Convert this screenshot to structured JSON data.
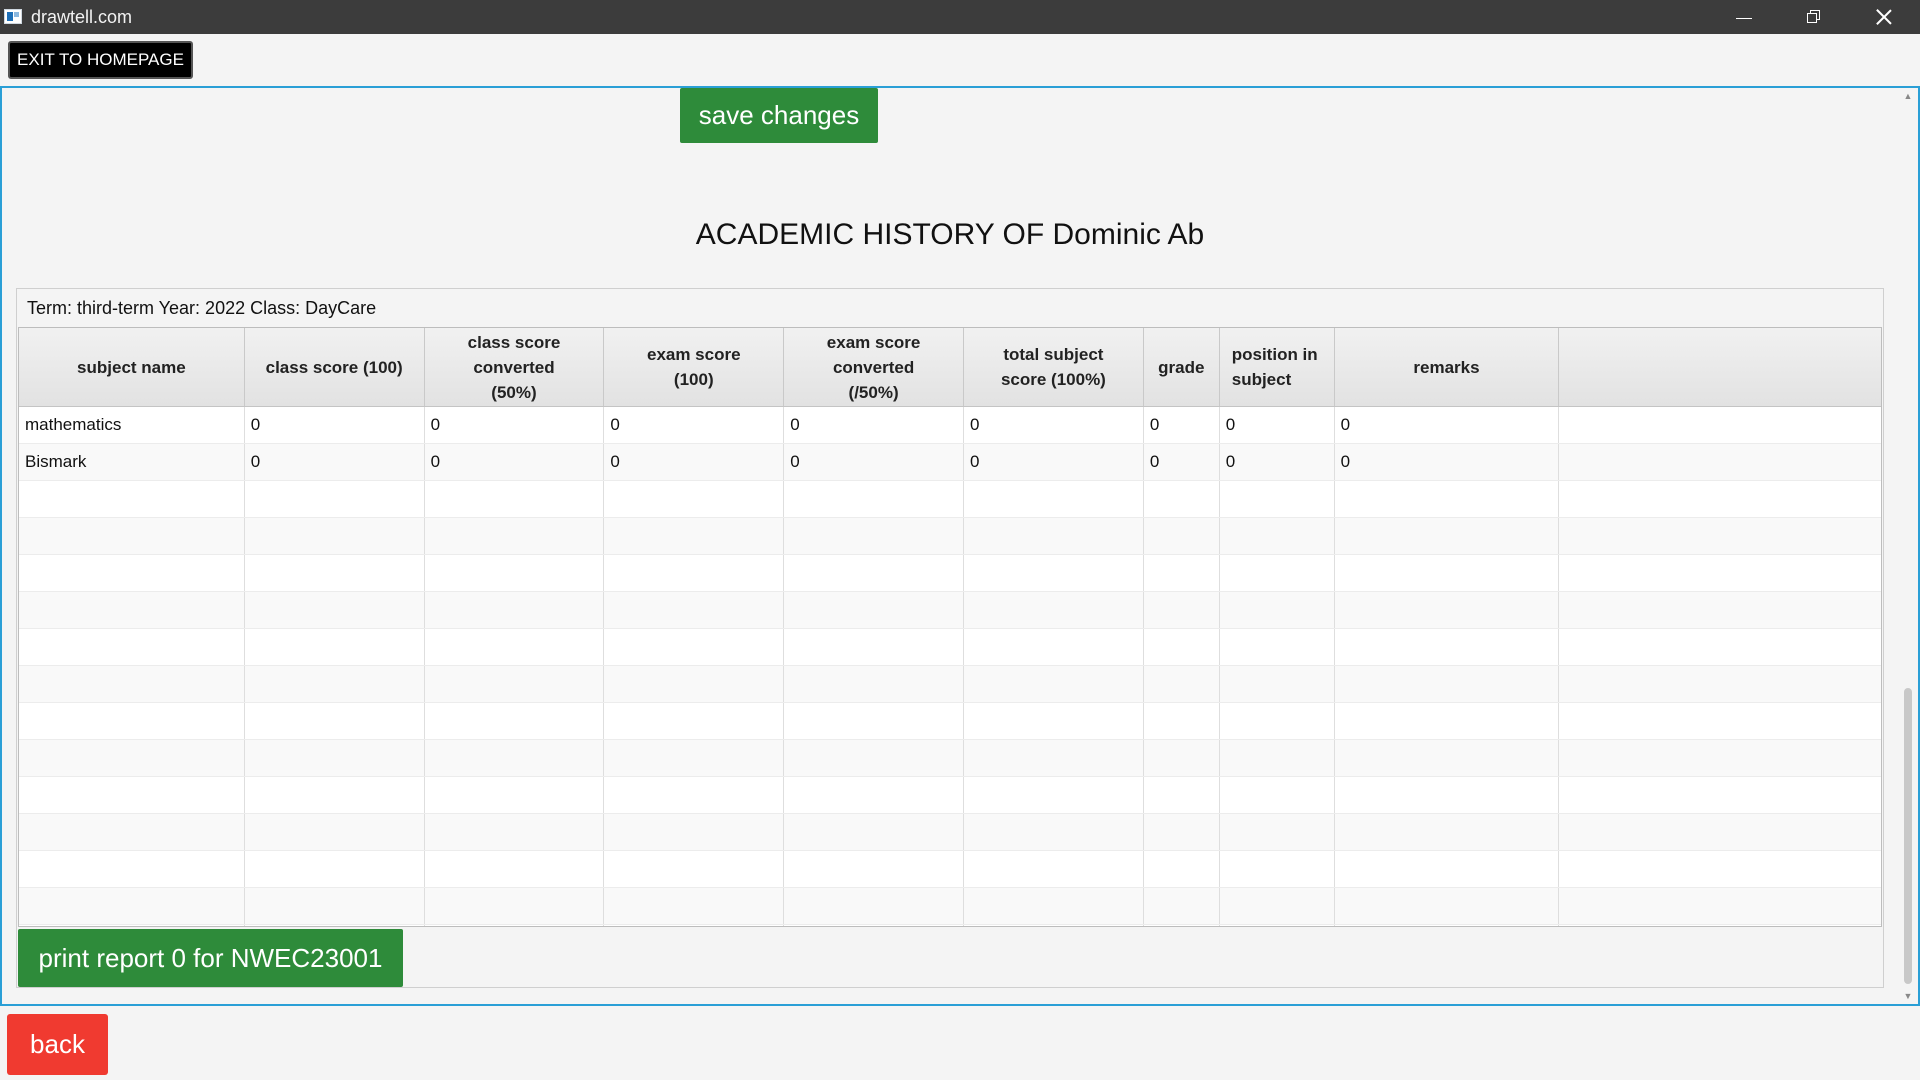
{
  "window": {
    "title": "drawtell.com",
    "icon": "app-window-icon",
    "controls": [
      "minimize-icon",
      "maximize-icon",
      "close-icon"
    ]
  },
  "toolbar": {
    "exit_label": "EXIT TO HOMEPAGE"
  },
  "main": {
    "save_label": "save changes",
    "title": "ACADEMIC HISTORY OF Dominic Ab",
    "caption": "Term: third-term  Year: 2022  Class: DayCare",
    "print_label": "print report 0 for NWEC23001"
  },
  "table": {
    "headers": [
      "subject name",
      "class score (100)",
      "class score\nconverted\n(50%)",
      "exam score\n(100)",
      "exam score\nconverted\n(/50%)",
      "total subject\nscore (100%)",
      "grade",
      "position in\nsubject",
      "remarks",
      ""
    ],
    "rows": [
      [
        "mathematics",
        "0",
        "0",
        "0",
        "0",
        "0",
        "0",
        "0",
        "0",
        ""
      ],
      [
        "Bismark",
        "0",
        "0",
        "0",
        "0",
        "0",
        "0",
        "0",
        "0",
        ""
      ]
    ],
    "empty_rows": 13
  },
  "footer": {
    "back_label": "back"
  },
  "colors": {
    "titlebar": "#3c3c3c",
    "accent_green": "#2e8b3a",
    "back_red": "#f03a30",
    "focus_border": "#2a9fd6",
    "exit_black": "#000000"
  }
}
